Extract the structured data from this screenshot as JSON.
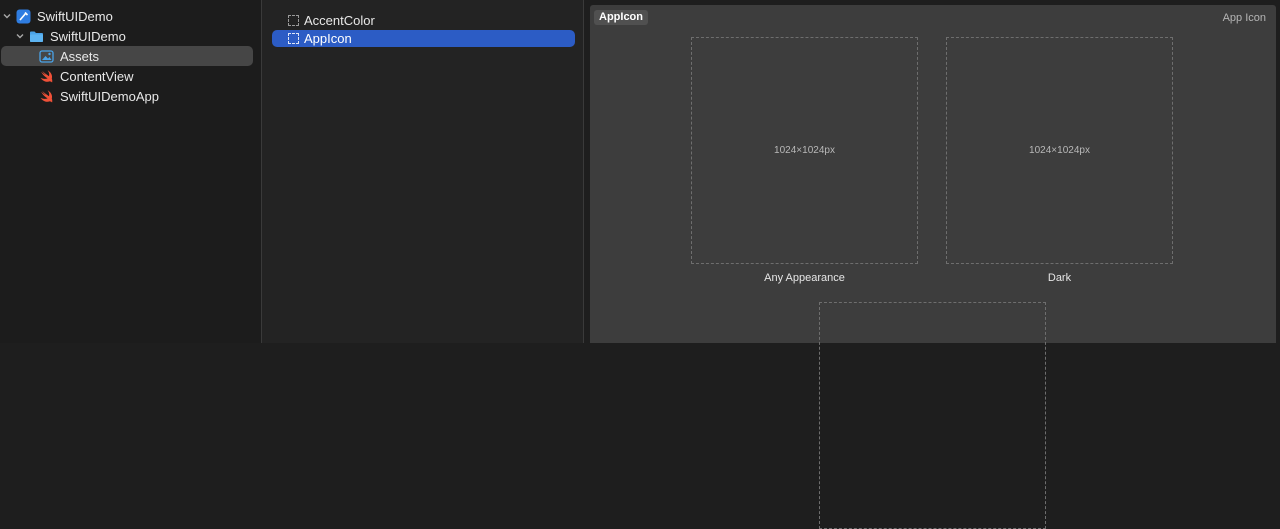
{
  "navigator": {
    "items": [
      {
        "label": "SwiftUIDemo",
        "icon": "xcode-project-icon",
        "expanded": true
      },
      {
        "label": "SwiftUIDemo",
        "icon": "folder-icon",
        "expanded": true
      },
      {
        "label": "Assets",
        "icon": "asset-catalog-icon",
        "selected": true
      },
      {
        "label": "ContentView",
        "icon": "swift-file-icon"
      },
      {
        "label": "SwiftUIDemoApp",
        "icon": "swift-file-icon"
      }
    ]
  },
  "asset_list": {
    "items": [
      {
        "label": "AccentColor",
        "icon": "color-set-icon"
      },
      {
        "label": "AppIcon",
        "icon": "app-icon-set-icon",
        "selected": true
      }
    ]
  },
  "editor": {
    "set_name": "AppIcon",
    "set_kind": "App Icon",
    "slots": [
      {
        "size_label": "1024×1024px",
        "caption": "Any Appearance"
      },
      {
        "size_label": "1024×1024px",
        "caption": "Dark"
      },
      {
        "size_label": "",
        "caption": ""
      }
    ]
  },
  "colors": {
    "selection": "#2c5cc5",
    "swift": "#f05138",
    "folder": "#4aa3e8"
  }
}
